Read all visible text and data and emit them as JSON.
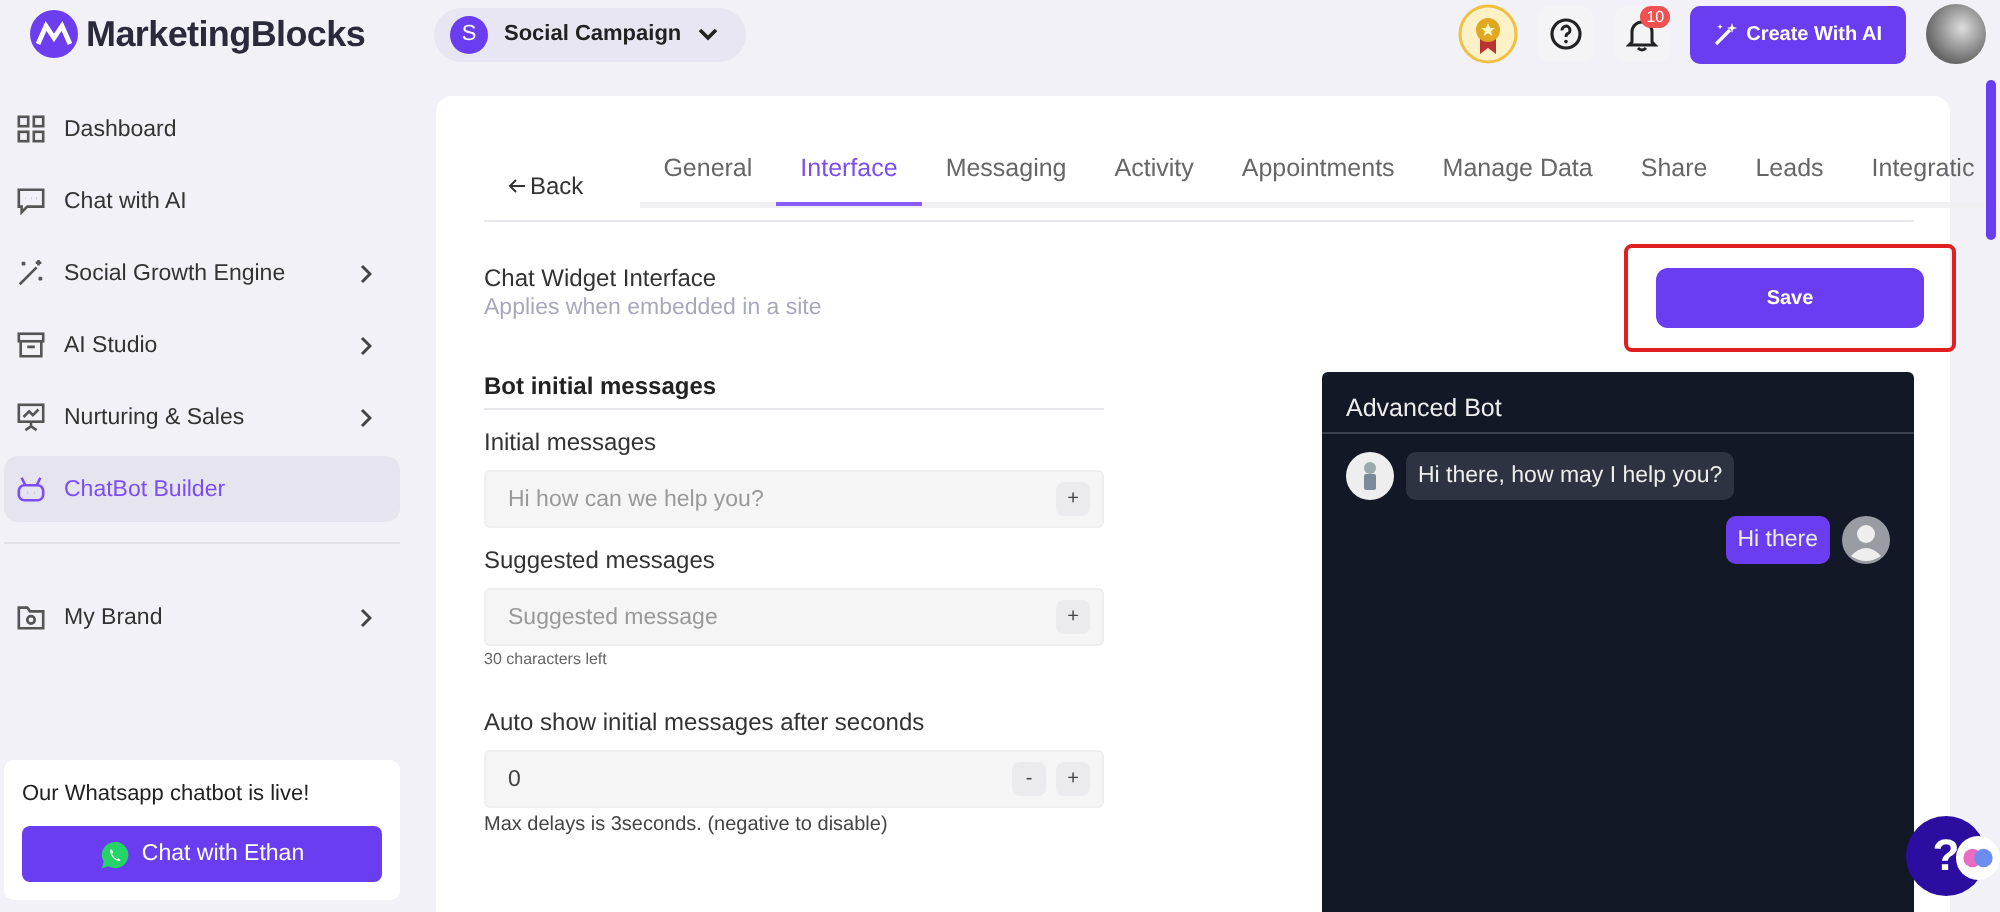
{
  "header": {
    "brand": "MarketingBlocks",
    "campaign": {
      "initial": "S",
      "name": "Social Campaign"
    },
    "notifications": "10",
    "create_button": "Create With AI"
  },
  "sidebar": {
    "items": [
      {
        "kind": "grid",
        "label": "Dashboard",
        "selected": false,
        "has_submenu": false
      },
      {
        "kind": "chat",
        "label": "Chat with AI",
        "selected": false,
        "has_submenu": false
      },
      {
        "kind": "wand",
        "label": "Social Growth Engine",
        "selected": false,
        "has_submenu": true
      },
      {
        "kind": "archive",
        "label": "AI Studio",
        "selected": false,
        "has_submenu": true
      },
      {
        "kind": "board",
        "label": "Nurturing & Sales",
        "selected": false,
        "has_submenu": true
      },
      {
        "kind": "bot",
        "label": "ChatBot Builder",
        "selected": true,
        "has_submenu": false
      },
      {
        "kind": "folder",
        "label": "My Brand",
        "selected": false,
        "has_submenu": true
      }
    ],
    "promo": {
      "text": "Our Whatsapp chatbot is live!",
      "button": "Chat with Ethan"
    }
  },
  "back": "Back",
  "tabs": [
    {
      "label": "General",
      "selected": false
    },
    {
      "label": "Interface",
      "selected": true
    },
    {
      "label": "Messaging",
      "selected": false
    },
    {
      "label": "Activity",
      "selected": false
    },
    {
      "label": "Appointments",
      "selected": false
    },
    {
      "label": "Manage Data",
      "selected": false
    },
    {
      "label": "Share",
      "selected": false
    },
    {
      "label": "Leads",
      "selected": false
    },
    {
      "label": "Integratic",
      "selected": false
    }
  ],
  "section": {
    "title": "Chat Widget Interface",
    "subtitle": "Applies when embedded in a site"
  },
  "save_button": {
    "label": "Save",
    "highlighted": true
  },
  "group_title": "Bot initial messages",
  "fields": [
    {
      "label": "Initial messages",
      "placeholder": "Hi how can we help you?",
      "kind": "add",
      "buttons": [
        "+"
      ]
    },
    {
      "label": "Suggested messages",
      "placeholder": "Suggested message",
      "kind": "add",
      "buttons": [
        "+"
      ],
      "hint": "30 characters left"
    },
    {
      "label": "Auto show initial messages after seconds",
      "value": "0",
      "kind": "stepper",
      "buttons": [
        "-",
        "+"
      ],
      "hint": "Max delays is 3seconds. (negative to disable)"
    }
  ],
  "preview": {
    "title": "Advanced Bot",
    "messages": [
      {
        "kind": "bot",
        "text": "Hi there, how may I help you?"
      },
      {
        "kind": "user",
        "text": "Hi there"
      }
    ]
  },
  "help_bubble": "?"
}
